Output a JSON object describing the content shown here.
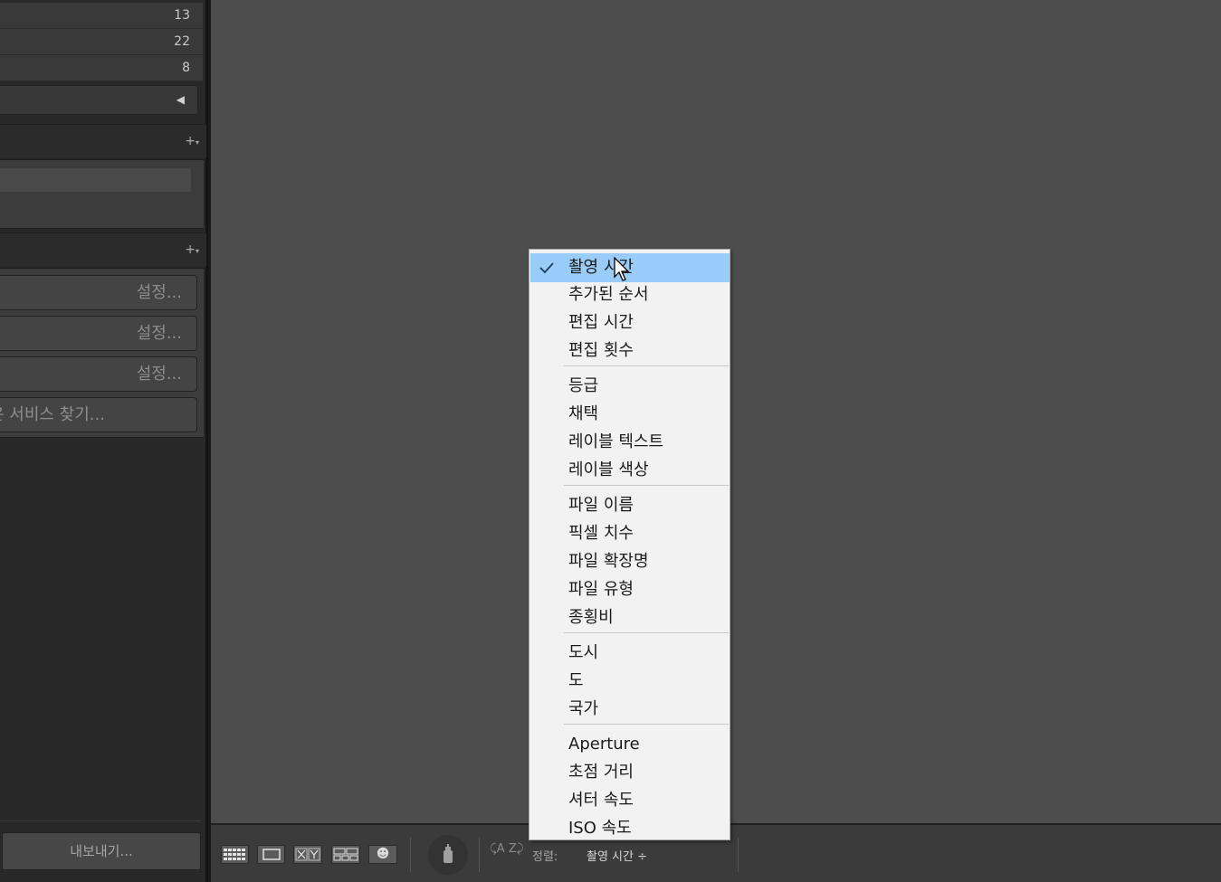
{
  "left_panel": {
    "counts": [
      "13",
      "22",
      "8"
    ],
    "publish_buttons": [
      "설정...",
      "설정...",
      "설정..."
    ],
    "find_services_label": "은 서비스 찾기...",
    "export_label": "내보내기..."
  },
  "toolbar": {
    "people_view_icon": "☻",
    "sort_label": "정렬:",
    "sort_value": "촬영 시간 ÷",
    "sort_direction_icon": "⤹A Z⤸"
  },
  "sort_menu": {
    "groups": [
      [
        "촬영 시간",
        "추가된 순서",
        "편집 시간",
        "편집 횟수"
      ],
      [
        "등급",
        "채택",
        "레이블 텍스트",
        "레이블 색상"
      ],
      [
        "파일 이름",
        "픽셀 치수",
        "파일 확장명",
        "파일 유형",
        "종횡비"
      ],
      [
        "도시",
        "도",
        "국가"
      ],
      [
        "Aperture",
        "초점 거리",
        "셔터 속도",
        "ISO 속도"
      ]
    ],
    "selected": "촬영 시간"
  },
  "colors": {
    "menu_bg": "#f2f2f2",
    "menu_highlight": "#99ccf8",
    "main_bg": "#4d4d4d",
    "panel_bg": "#282828"
  }
}
